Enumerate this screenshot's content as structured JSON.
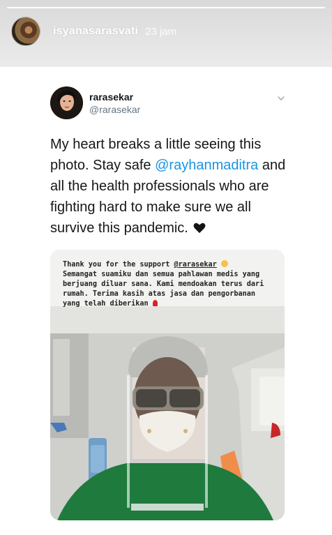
{
  "story": {
    "username": "isyanasarasvati",
    "time": "23 jam"
  },
  "tweet": {
    "author_name": "rarasekar",
    "author_handle": "@rarasekar",
    "text_before": "My heart breaks a little seeing this photo. Stay safe ",
    "mention": "@rayhanmaditra",
    "text_after": " and all the health professionals who are fighting hard to make sure we all survive this pandemic."
  },
  "photo_caption": {
    "line1_before": "Thank you for the support ",
    "mention": "@rarasekar",
    "line2": "Semangat suamiku dan semua pahlawan medis yang berjuang diluar sana. Kami mendoakan terus dari rumah. Terima kasih atas jasa dan pengorbanan yang telah diberikan"
  },
  "colors": {
    "link": "#1b95e0",
    "text": "#14171a",
    "muted": "#657786"
  },
  "icons": [
    "chevron-down-icon",
    "black-heart-emoji",
    "pleading-face-emoji",
    "rose-emoji"
  ]
}
